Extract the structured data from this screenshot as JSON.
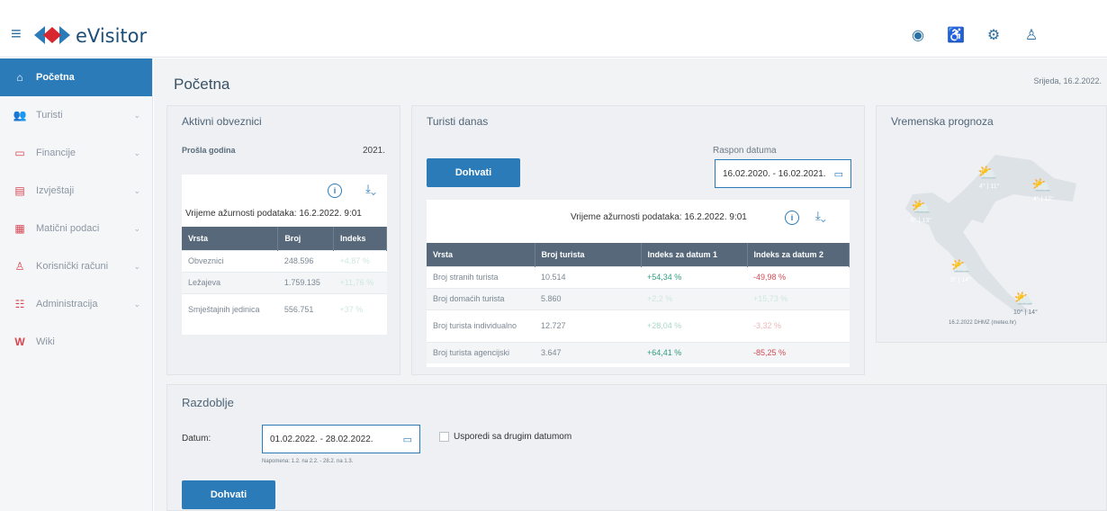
{
  "app": {
    "brand": "eVisitor"
  },
  "sidebar": {
    "items": [
      {
        "label": "Početna",
        "icon": "home-icon"
      },
      {
        "label": "Turisti",
        "icon": "people-icon"
      },
      {
        "label": "Financije",
        "icon": "money-icon"
      },
      {
        "label": "Izvještaji",
        "icon": "report-icon"
      },
      {
        "label": "Matični podaci",
        "icon": "document-icon"
      },
      {
        "label": "Korisnički računi",
        "icon": "user-icon"
      },
      {
        "label": "Administracija",
        "icon": "admin-icon"
      },
      {
        "label": "Wiki",
        "icon": "wiki-icon"
      }
    ]
  },
  "page": {
    "title": "Početna",
    "date": "Srijeda, 16.2.2022."
  },
  "aktivni": {
    "title": "Aktivni obveznici",
    "year_label": "Prošla godina",
    "year_value": "2021.",
    "updated": "Vrijeme ažurnosti podataka: 16.2.2022. 9:01",
    "headers": [
      "Vrsta",
      "Broj",
      "Indeks"
    ],
    "rows": [
      {
        "vrsta": "Obveznici",
        "broj": "248.596",
        "indeks": "+4,87 %"
      },
      {
        "vrsta": "Ležajeva",
        "broj": "1.759.135",
        "indeks": "+11,76 %"
      },
      {
        "vrsta": "Smještajnih jedinica",
        "broj": "556.751",
        "indeks": "+37 %"
      }
    ]
  },
  "turisti": {
    "title": "Turisti danas",
    "button": "Dohvati",
    "range_label": "Raspon datuma",
    "range_value": "16.02.2020. - 16.02.2021.",
    "updated": "Vrijeme ažurnosti podataka: 16.2.2022. 9:01",
    "headers": [
      "Vrsta",
      "Broj turista",
      "Indeks za datum 1",
      "Indeks za datum 2"
    ],
    "rows": [
      {
        "vrsta": "Broj stranih turista",
        "broj": "10.514",
        "i1": "+54,34 %",
        "i2": "-49,98 %"
      },
      {
        "vrsta": "Broj domaćih turista",
        "broj": "5.860",
        "i1": "+2,2 %",
        "i2": "+15,73 %"
      },
      {
        "vrsta": "Broj turista individualno",
        "broj": "12.727",
        "i1": "+28,04 %",
        "i2": "-3,32 %"
      },
      {
        "vrsta": "Broj turista agencijski",
        "broj": "3.647",
        "i1": "+64,41 %",
        "i2": "-85,25 %"
      }
    ]
  },
  "prognoza": {
    "title": "Vremenska prognoza",
    "temps": [
      "4° | 11°",
      "4° | 12°",
      "6° | 13°",
      "9° | 14°",
      "10° | 14°"
    ],
    "source": "16.2.2022 DHMZ (meteo.hr)"
  },
  "razdoblje": {
    "title": "Razdoblje",
    "datum_label": "Datum:",
    "datum_value": "01.02.2022. - 28.02.2022.",
    "hint": "Napomena: 1.2. na 2.2. - 28.2. na 1.3.",
    "compare_label": "Usporedi sa drugim datumom",
    "button": "Dohvati"
  },
  "colors": {
    "accent": "#2b7bb9",
    "positive": "#2f9e7e",
    "negative": "#d24b55",
    "header_bg": "#56687a"
  }
}
